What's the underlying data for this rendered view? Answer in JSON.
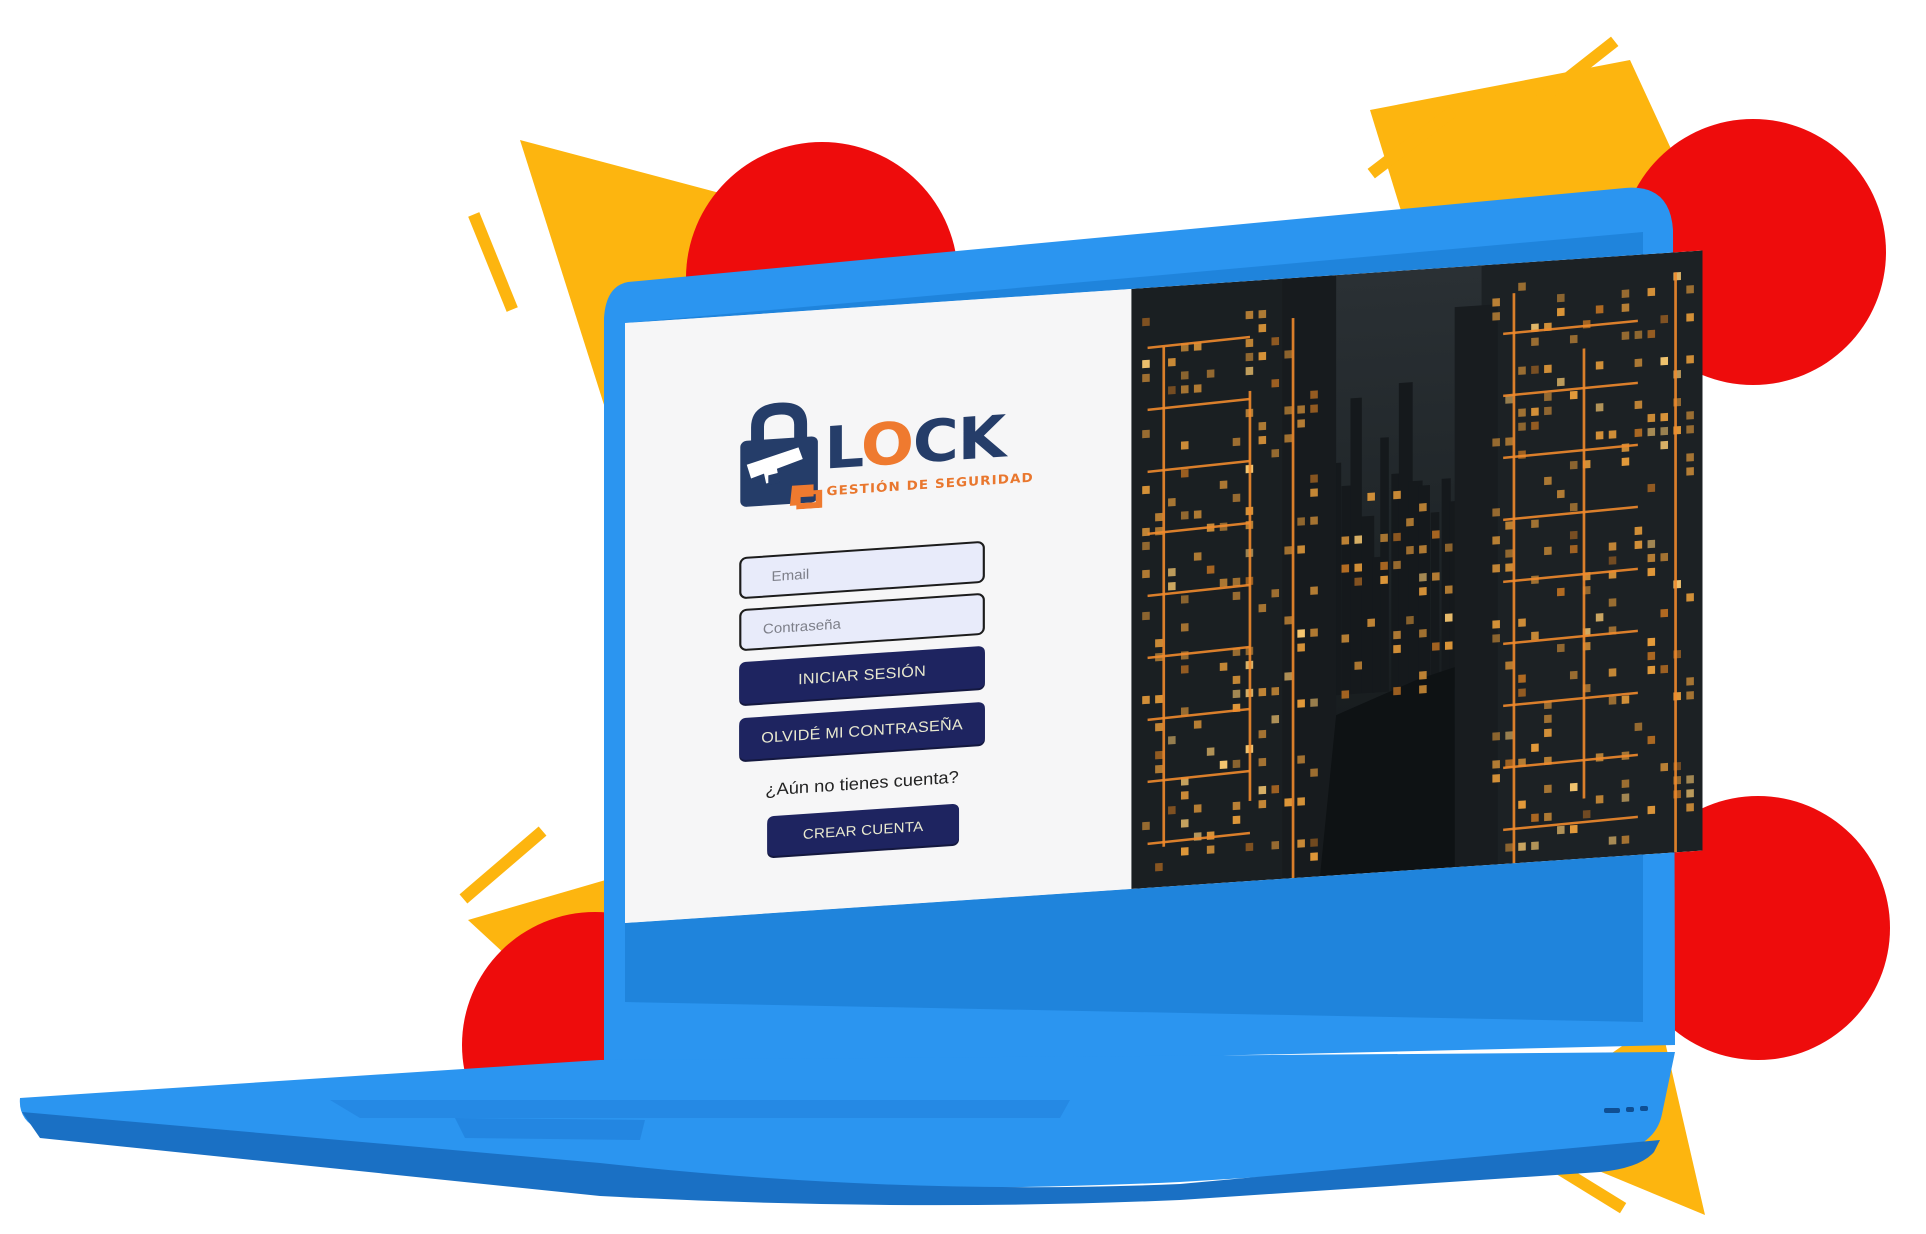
{
  "brand": {
    "name_prefix": "L",
    "name_o": "O",
    "name_suffix": "CK",
    "tagline": "GESTIÓN DE SEGURIDAD",
    "lettering": "LOCK"
  },
  "login": {
    "email_placeholder": "Email",
    "password_placeholder": "Contraseña",
    "login_button": "INICIAR SESIÓN",
    "forgot_button": "OLVIDÉ MI CONTRASEÑA",
    "no_account_question": "¿Aún no tienes cuenta?",
    "create_button": "CREAR CUENTA"
  },
  "colors": {
    "laptop_blue": "#2b95f0",
    "laptop_dark": "#1a70c4",
    "deco_yellow": "#fdb50f",
    "deco_red": "#ee0c0c",
    "button_navy": "#1e2460",
    "button_text": "#e9e9cf",
    "field_fill": "#e8ebfa",
    "logo_navy": "#253d69",
    "logo_orange": "#ef7a2f",
    "screen_bg": "#f6f6f7"
  },
  "photo": {
    "subject": "night-city-skyline-icon"
  }
}
